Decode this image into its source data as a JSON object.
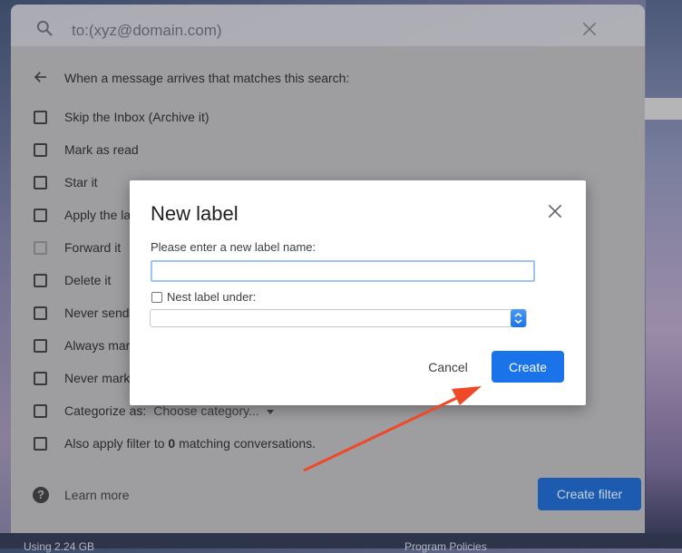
{
  "search": {
    "query": "to:(xyz@domain.com)"
  },
  "filter_panel": {
    "header": "When a message arrives that matches this search:",
    "options": [
      {
        "label": "Skip the Inbox (Archive it)"
      },
      {
        "label": "Mark as read"
      },
      {
        "label": "Star it"
      },
      {
        "label": "Apply the la"
      },
      {
        "label": "Forward it"
      },
      {
        "label": "Delete it"
      },
      {
        "label": "Never send"
      },
      {
        "label": "Always mar"
      },
      {
        "label": "Never mark"
      },
      {
        "label": "Categorize as:"
      },
      {
        "label_prefix": "Also apply filter to ",
        "count": "0",
        "label_suffix": " matching conversations."
      }
    ],
    "category_placeholder": "Choose category...",
    "learn_more": "Learn more",
    "create_filter_button": "Create filter"
  },
  "bottom_bar": {
    "storage": "Using 2.24 GB",
    "policies": "Program Policies"
  },
  "modal": {
    "title": "New label",
    "prompt": "Please enter a new label name:",
    "input_value": "",
    "nest_label": "Nest label under:",
    "nest_select_value": "",
    "cancel_button": "Cancel",
    "create_button": "Create"
  },
  "colors": {
    "primary": "#1a73e8",
    "annotation_arrow": "#ee4a2a"
  }
}
